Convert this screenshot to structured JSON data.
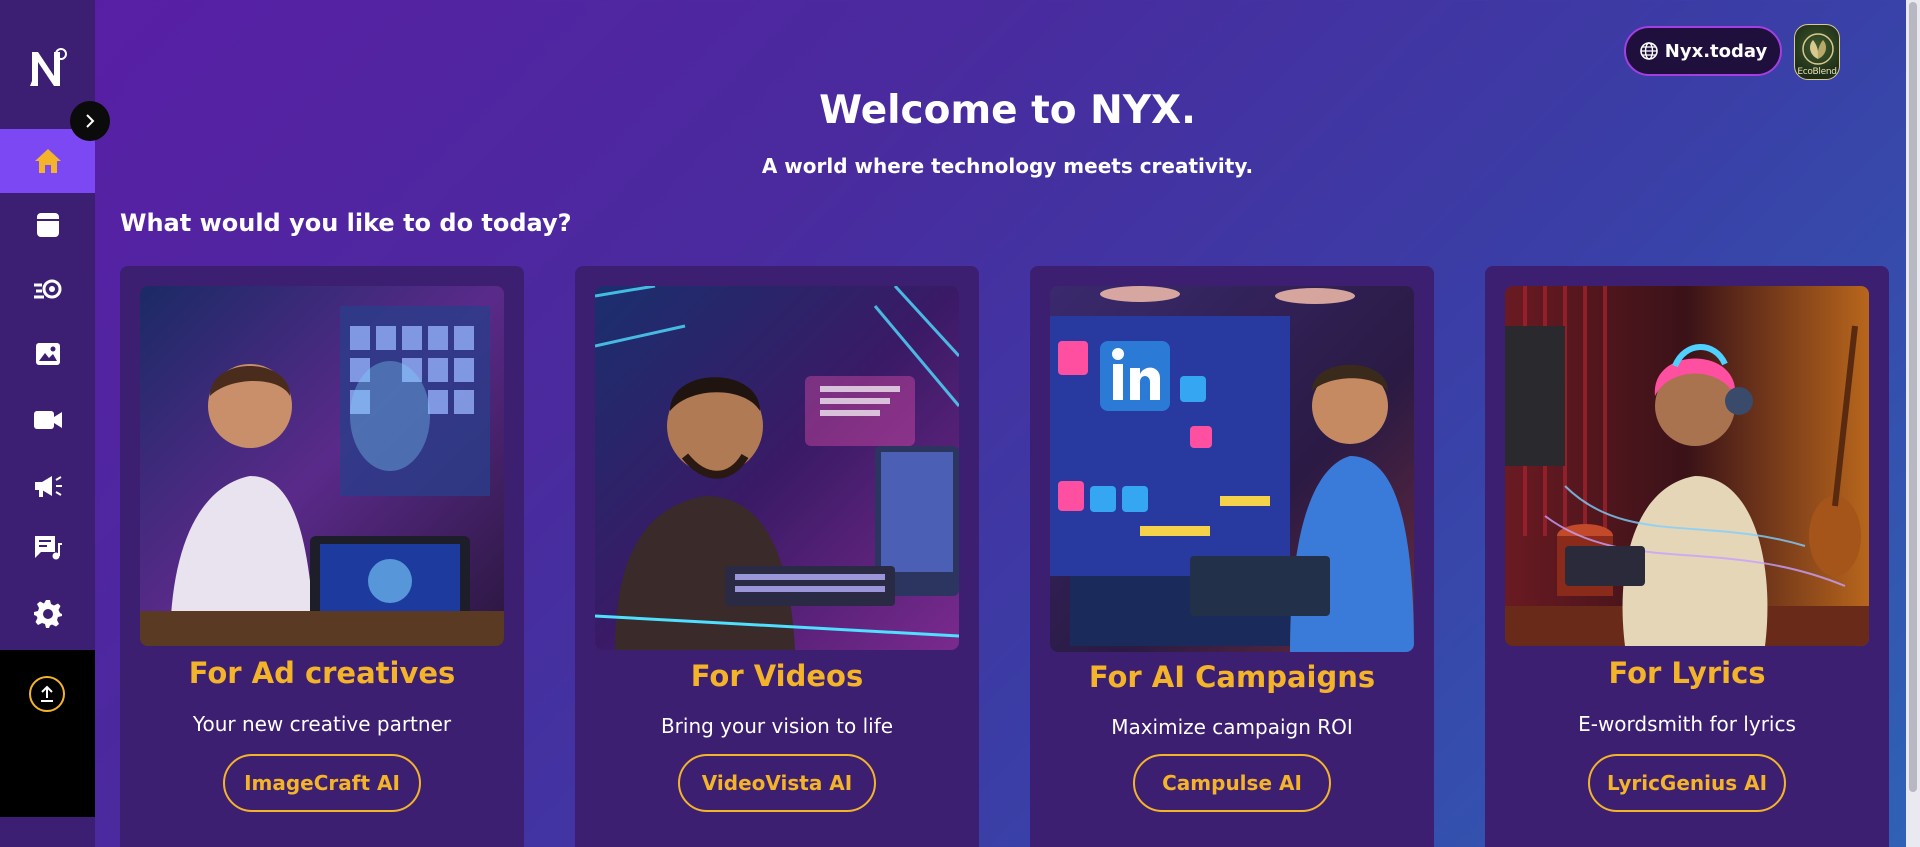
{
  "app": {
    "name": "NYX"
  },
  "header": {
    "site_button": "Nyx.today",
    "avatar_label": "EcoBlend"
  },
  "hero": {
    "title": "Welcome to NYX.",
    "subtitle": "A world where technology meets creativity."
  },
  "section": {
    "question": "What would you like to do today?"
  },
  "sidebar": {
    "items": [
      {
        "icon": "home-icon",
        "active": true
      },
      {
        "icon": "document-icon",
        "active": false
      },
      {
        "icon": "campaign-settings-icon",
        "active": false
      },
      {
        "icon": "image-icon",
        "active": false
      },
      {
        "icon": "video-icon",
        "active": false
      },
      {
        "icon": "megaphone-icon",
        "active": false
      },
      {
        "icon": "lyrics-icon",
        "active": false
      },
      {
        "icon": "gear-icon",
        "active": false
      }
    ]
  },
  "cards": [
    {
      "title": "For Ad creatives",
      "desc": "Your new creative partner",
      "button": "ImageCraft AI"
    },
    {
      "title": "For Videos",
      "desc": "Bring your vision to life",
      "button": "VideoVista AI"
    },
    {
      "title": "For AI Campaigns",
      "desc": "Maximize campaign ROI",
      "button": "Campulse AI"
    },
    {
      "title": "For Lyrics",
      "desc": "E-wordsmith for lyrics",
      "button": "LyricGenius AI"
    }
  ],
  "colors": {
    "accent": "#f4b42a",
    "active_nav": "#7b48f4",
    "card_bg": "#3d1f72",
    "sidebar_bg": "#3c1f72"
  }
}
